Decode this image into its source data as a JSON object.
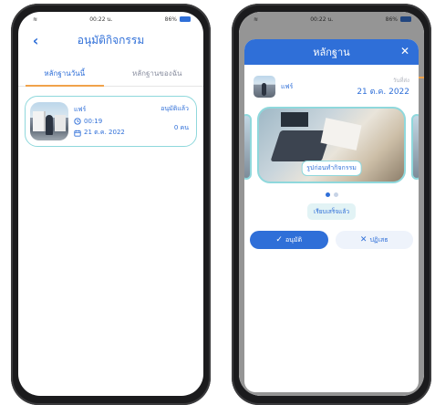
{
  "status_bar": {
    "time": "00:22 น.",
    "battery_text": "86%"
  },
  "left_screen": {
    "title": "อนุมัติกิจกรรม",
    "tabs": [
      {
        "label": "หลักฐานวันนี้",
        "active": true
      },
      {
        "label": "หลักฐานของฉัน",
        "active": false
      }
    ],
    "card": {
      "name": "แฟร์",
      "time": "00:19",
      "date": "21 ต.ค. 2022",
      "approved_label": "อนุมัติแล้ว",
      "approved_count": "0 คน"
    }
  },
  "right_screen": {
    "modal_title": "หลักฐาน",
    "user_name": "แฟร์",
    "sent_label": "วันที่ส่ง",
    "sent_date": "21 ต.ค. 2022",
    "image_caption": "รูปก่อนทำกิจกรรม",
    "carousel_active_index": 0,
    "carousel_count": 2,
    "status_pill": "เรียบเสร็จแล้ว",
    "approve_label": "อนุมัติ",
    "reject_label": "ปฏิเสธ"
  },
  "colors": {
    "primary": "#2f6fd8",
    "accent_tab": "#f0a24a",
    "card_border": "#8fd8dc"
  },
  "icons": [
    "back-arrow-icon",
    "clock-icon",
    "calendar-icon",
    "close-icon",
    "check-icon",
    "x-icon"
  ]
}
